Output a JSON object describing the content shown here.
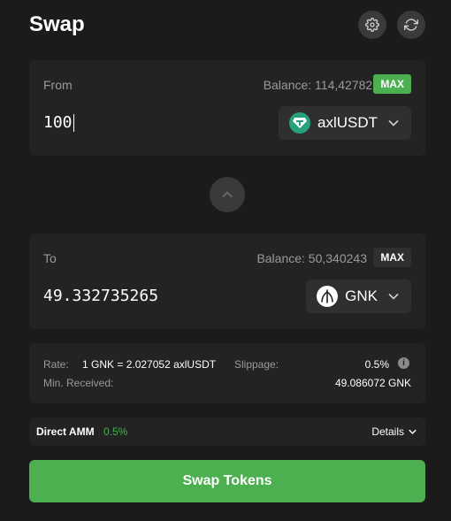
{
  "header": {
    "title": "Swap",
    "settings_icon": "gear-icon",
    "refresh_icon": "refresh-icon"
  },
  "from": {
    "label": "From",
    "balance": "Balance: 114,427826",
    "max_label": "MAX",
    "amount": "100",
    "token": {
      "name": "axlUSDT",
      "icon": "tether-gem-icon",
      "color": "#26a17b"
    }
  },
  "to": {
    "label": "To",
    "balance": "Balance: 50,340243",
    "max_label": "MAX",
    "amount": "49.332735265",
    "token": {
      "name": "GNK",
      "icon": "gnk-leaf-icon",
      "color": "#ffffff"
    }
  },
  "rate": {
    "rate_label": "Rate:",
    "rate_value": "1 GNK = 2.027052 axlUSDT",
    "slippage_label": "Slippage:",
    "slippage_value": "0.5%",
    "min_received_label": "Min. Received:",
    "min_received_value": "49.086072 GNK"
  },
  "route": {
    "name": "Direct AMM",
    "fee": "0.5%",
    "details_label": "Details"
  },
  "swap_button": "Swap Tokens",
  "colors": {
    "accent": "#4caf50",
    "background": "#1b1b1b",
    "panel": "#232323"
  }
}
